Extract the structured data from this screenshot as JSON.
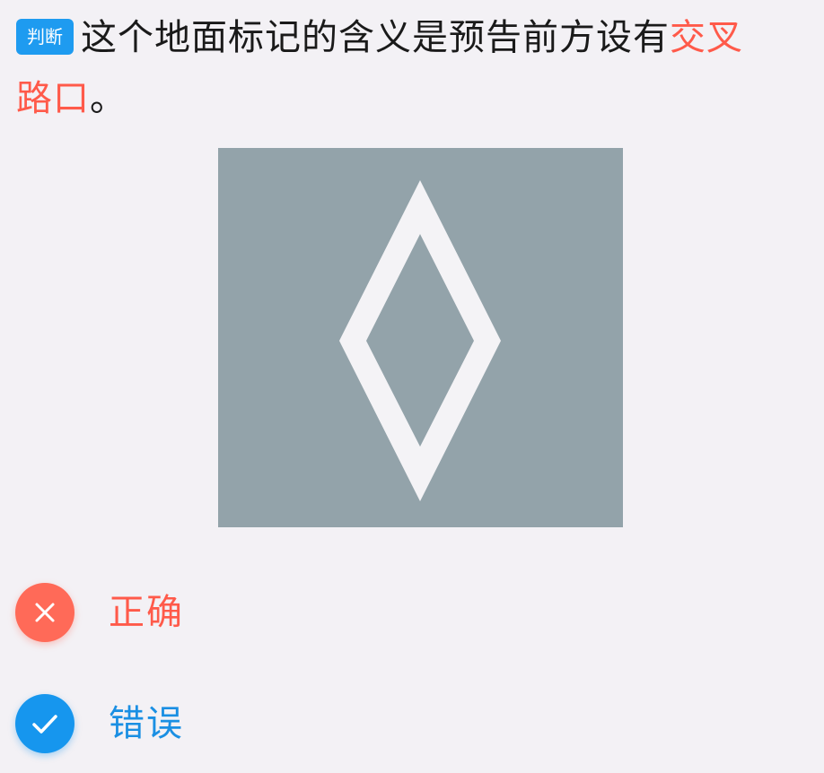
{
  "question": {
    "type_badge": "判断",
    "text_before": "这个地面标记的含义是预告前方设有",
    "text_highlight_1": "交叉",
    "text_highlight_2": "路口",
    "text_after": "。"
  },
  "image": {
    "icon": "diamond-road-marking-icon",
    "background_color": "#93a3aa",
    "mark_color": "#f4f3f6"
  },
  "options": [
    {
      "label": "正确",
      "state": "wrong",
      "icon": "close-icon",
      "color": "#ff5a4a"
    },
    {
      "label": "错误",
      "state": "correct",
      "icon": "check-icon",
      "color": "#1696ee"
    }
  ],
  "colors": {
    "highlight": "#ff5a4a",
    "badge": "#1e9bf0",
    "background": "#f3f1f5"
  }
}
